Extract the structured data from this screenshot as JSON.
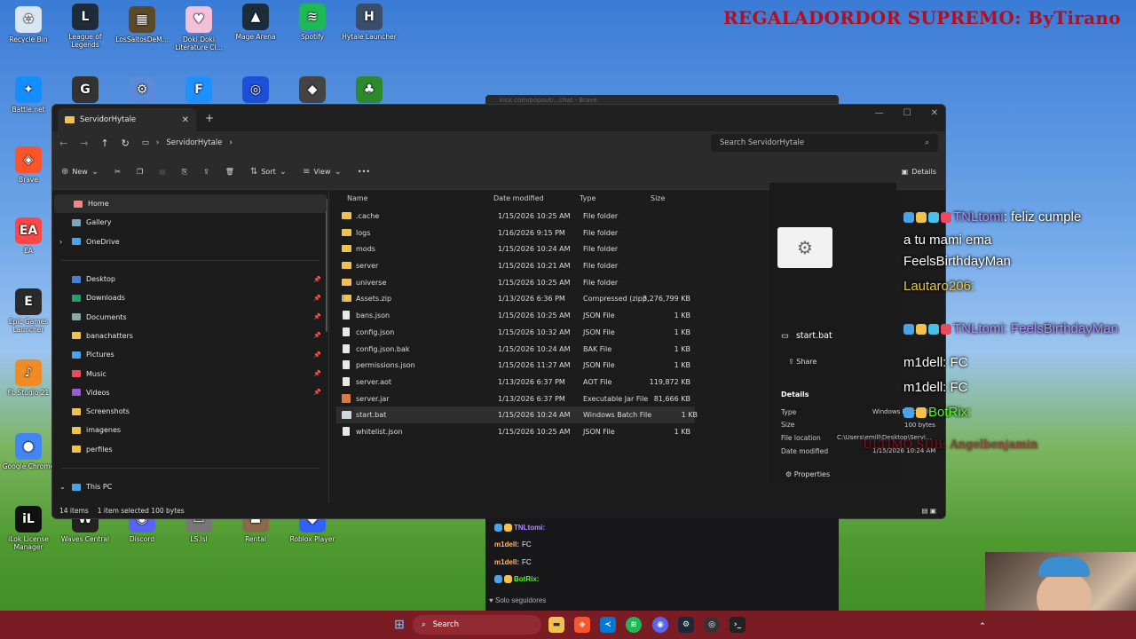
{
  "banner": "REGALADORDOR SUPREMO: ByTirano",
  "desktop_icons": [
    {
      "label": "Recycle Bin",
      "color": "#d9e6f2",
      "glyph": "♻"
    },
    {
      "label": "League of Legends",
      "color": "#1d2b3a",
      "glyph": "L"
    },
    {
      "label": "LosSaltosDeM...",
      "color": "#5a4a2a",
      "glyph": "▦"
    },
    {
      "label": "Doki Doki Literature Cl...",
      "color": "#f2c0d8",
      "glyph": "♥"
    },
    {
      "label": "Mage Arena",
      "color": "#1b2c3b",
      "glyph": "▲"
    },
    {
      "label": "Spotify",
      "color": "#1db954",
      "glyph": "≋"
    },
    {
      "label": "Hytale Launcher",
      "color": "#3a4d6a",
      "glyph": "H"
    },
    {
      "label": "Battle.net",
      "color": "#148eff",
      "glyph": "✦"
    },
    {
      "label": "Brave",
      "color": "#fb542b",
      "glyph": "◈"
    },
    {
      "label": "EA",
      "color": "#ff4747",
      "glyph": "EA"
    },
    {
      "label": "Epic Games Launcher",
      "color": "#2a2a2a",
      "glyph": "E"
    },
    {
      "label": "FL Studio 21",
      "color": "#f08a24",
      "glyph": "♪"
    },
    {
      "label": "Google Chrome",
      "color": "#4285f4",
      "glyph": "●"
    },
    {
      "label": "iLok License Manager",
      "color": "#111",
      "glyph": "iL"
    },
    {
      "label": "Waves Central",
      "color": "#222",
      "glyph": "W"
    },
    {
      "label": "Discord",
      "color": "#5865f2",
      "glyph": "◉"
    },
    {
      "label": "LS.lsl",
      "color": "#777",
      "glyph": "▭"
    },
    {
      "label": "Rental",
      "color": "#8a6a4a",
      "glyph": "☗"
    },
    {
      "label": "Roblox Player",
      "color": "#335fff",
      "glyph": "◆"
    }
  ],
  "explorer": {
    "tab_title": "ServidorHytale",
    "breadcrumb": "ServidorHytale",
    "search_placeholder": "Search ServidorHytale",
    "toolbar": {
      "new": "New",
      "sort": "Sort",
      "view": "View",
      "details": "Details"
    },
    "sidebar": [
      {
        "label": "Home",
        "color": "#e88",
        "sel": true
      },
      {
        "label": "Gallery",
        "color": "#7ab"
      },
      {
        "label": "OneDrive",
        "color": "#4aa3e8"
      },
      {
        "label": "Desktop",
        "color": "#4a7fd8",
        "pin": true
      },
      {
        "label": "Downloads",
        "color": "#2c9a6a",
        "pin": true
      },
      {
        "label": "Documents",
        "color": "#8aa",
        "pin": true
      },
      {
        "label": "banachatters",
        "color": "#f2c14e",
        "pin": true
      },
      {
        "label": "Pictures",
        "color": "#4aa3e8",
        "pin": true
      },
      {
        "label": "Music",
        "color": "#e84a5f",
        "pin": true
      },
      {
        "label": "Videos",
        "color": "#9a5ad8",
        "pin": true
      },
      {
        "label": "Screenshots",
        "color": "#f2c14e"
      },
      {
        "label": "imagenes",
        "color": "#f2c14e"
      },
      {
        "label": "perfiles",
        "color": "#f2c14e"
      },
      {
        "label": "This PC",
        "color": "#4aa3e8"
      },
      {
        "label": "Local Disk (C:)",
        "color": "#aaa"
      }
    ],
    "columns": {
      "name": "Name",
      "date": "Date modified",
      "type": "Type",
      "size": "Size"
    },
    "files": [
      {
        "name": ".cache",
        "date": "1/15/2026 10:25 AM",
        "type": "File folder",
        "size": "",
        "icon": "folder"
      },
      {
        "name": "logs",
        "date": "1/16/2026 9:15 PM",
        "type": "File folder",
        "size": "",
        "icon": "folder"
      },
      {
        "name": "mods",
        "date": "1/15/2026 10:24 AM",
        "type": "File folder",
        "size": "",
        "icon": "folder"
      },
      {
        "name": "server",
        "date": "1/15/2026 10:21 AM",
        "type": "File folder",
        "size": "",
        "icon": "folder"
      },
      {
        "name": "universe",
        "date": "1/15/2026 10:25 AM",
        "type": "File folder",
        "size": "",
        "icon": "folder"
      },
      {
        "name": "Assets.zip",
        "date": "1/13/2026 6:36 PM",
        "type": "Compressed (zipp...",
        "size": "3,276,799 KB",
        "icon": "zip"
      },
      {
        "name": "bans.json",
        "date": "1/15/2026 10:25 AM",
        "type": "JSON File",
        "size": "1 KB",
        "icon": "file"
      },
      {
        "name": "config.json",
        "date": "1/15/2026 10:32 AM",
        "type": "JSON File",
        "size": "1 KB",
        "icon": "file"
      },
      {
        "name": "config.json.bak",
        "date": "1/15/2026 10:24 AM",
        "type": "BAK File",
        "size": "1 KB",
        "icon": "file"
      },
      {
        "name": "permissions.json",
        "date": "1/15/2026 11:27 AM",
        "type": "JSON File",
        "size": "1 KB",
        "icon": "file"
      },
      {
        "name": "server.aot",
        "date": "1/13/2026 6:37 PM",
        "type": "AOT File",
        "size": "119,872 KB",
        "icon": "file"
      },
      {
        "name": "server.jar",
        "date": "1/13/2026 6:37 PM",
        "type": "Executable Jar File",
        "size": "81,666 KB",
        "icon": "jar"
      },
      {
        "name": "start.bat",
        "date": "1/15/2026 10:24 AM",
        "type": "Windows Batch File",
        "size": "1 KB",
        "icon": "bat",
        "sel": true
      },
      {
        "name": "whitelist.json",
        "date": "1/15/2026 10:25 AM",
        "type": "JSON File",
        "size": "1 KB",
        "icon": "file"
      }
    ],
    "status": {
      "items": "14 items",
      "selected": "1 item selected  100 bytes"
    },
    "details": {
      "name": "start.bat",
      "share": "Share",
      "heading": "Details",
      "type_k": "Type",
      "type_v": "Windows Batch File",
      "size_k": "Size",
      "size_v": "100 bytes",
      "loc_k": "File location",
      "loc_v": "C:\\Users\\emill\\Desktop\\Servi...",
      "date_k": "Date modified",
      "date_v": "1/15/2026 10:24 AM",
      "properties": "Properties"
    }
  },
  "stream_chat": [
    {
      "text": "feliz cumple",
      "user": "TNLtomi",
      "ucolor": "#b38cff"
    },
    {
      "text": "a tu mami ema"
    },
    {
      "text": "FeelsBirthdayMan"
    },
    {
      "text": "Lautaro206:",
      "ucolor": "#e8c84a"
    },
    {
      "text": "TNLtomi: FeelsBirthdayMan",
      "ucolor": "#b38cff"
    },
    {
      "text": "m1dell: FC"
    },
    {
      "text": "m1dell: FC"
    },
    {
      "text": "BotRix:",
      "ucolor": "#53fc18"
    },
    {
      "text": "ULTIMO SUB: Angelbenjamin",
      "ucolor": "#b01020"
    }
  ],
  "browser_chat": [
    {
      "user": "TNLtomi:",
      "text": ""
    },
    {
      "user": "m1dell:",
      "text": "FC"
    },
    {
      "user": "m1dell:",
      "text": "FC"
    },
    {
      "user": "BotRix:",
      "text": ""
    }
  ],
  "browser_title": "kick.com/popout/...chat - Brave",
  "solo_seguidores": "Solo seguidores",
  "taskbar": {
    "search": "Search"
  }
}
